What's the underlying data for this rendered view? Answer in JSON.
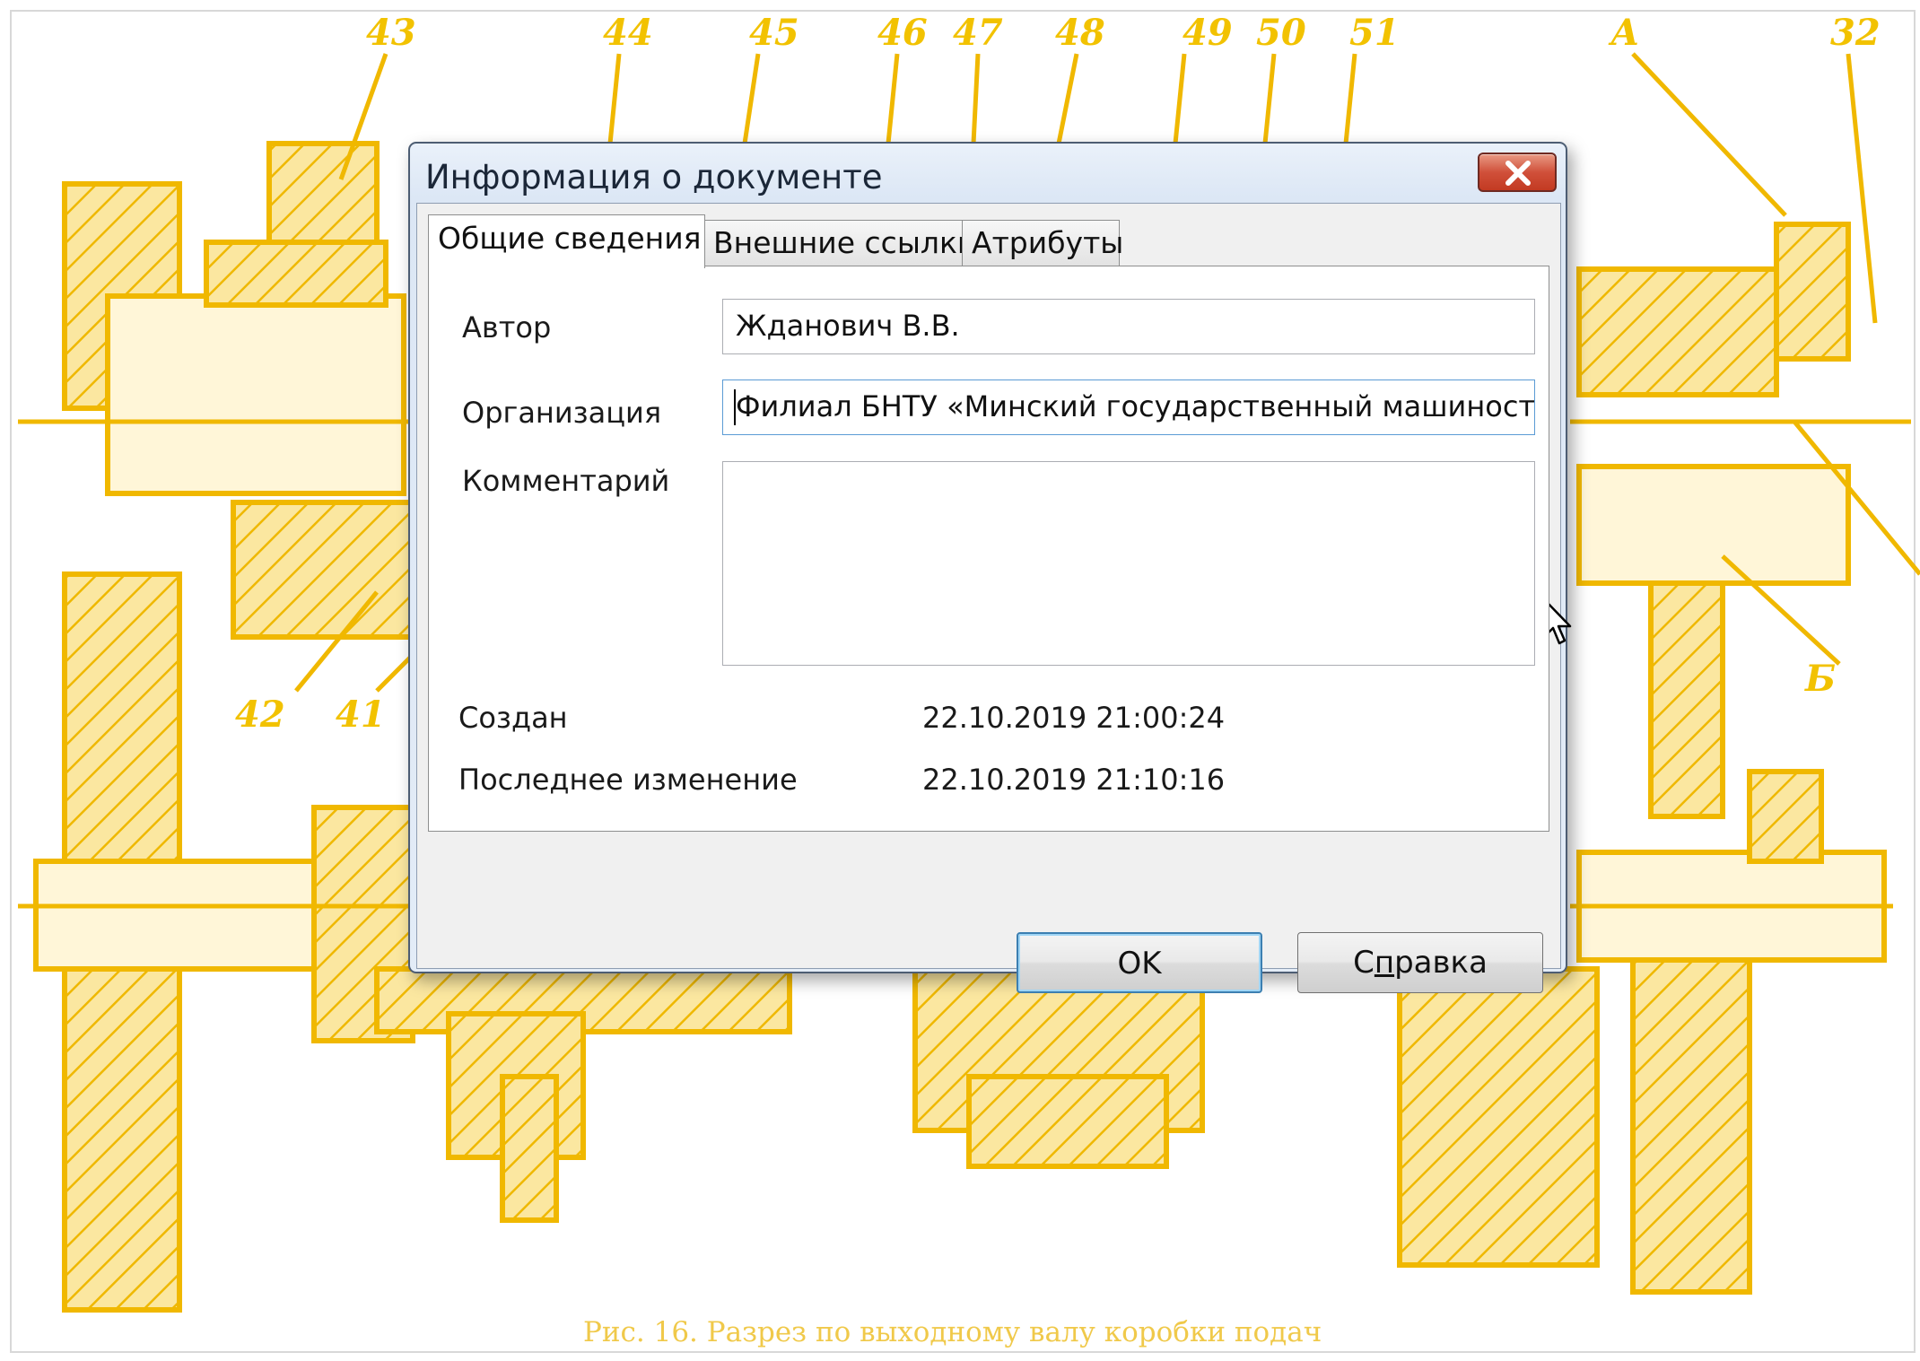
{
  "background": {
    "part_numbers": [
      "43",
      "44",
      "45",
      "46",
      "47",
      "48",
      "49",
      "50",
      "51",
      "А",
      "32",
      "42",
      "41",
      "Б"
    ],
    "caption": "Рис. 16. Разрез по выходному валу коробки подач",
    "drawing_color": "#f5c400"
  },
  "dialog": {
    "title": "Информация о документе",
    "close_icon": "close-x-icon",
    "tabs": [
      {
        "label": "Общие сведения",
        "active": true
      },
      {
        "label": "Внешние ссылки",
        "active": false
      },
      {
        "label": "Атрибуты",
        "active": false
      }
    ],
    "general": {
      "author_label": "Автор",
      "author_value": "Жданович В.В.",
      "organization_label": "Организация",
      "organization_value": "Филиал БНТУ «Минский государственный машиностроит",
      "comment_label": "Комментарий",
      "comment_value": "",
      "created_label": "Создан",
      "created_value": "22.10.2019 21:00:24",
      "modified_label": "Последнее изменение",
      "modified_value": "22.10.2019 21:10:16"
    },
    "buttons": {
      "ok_label": "OK",
      "help_label_pre": "С",
      "help_label_mnemonic": "п",
      "help_label_post": "равка"
    }
  }
}
